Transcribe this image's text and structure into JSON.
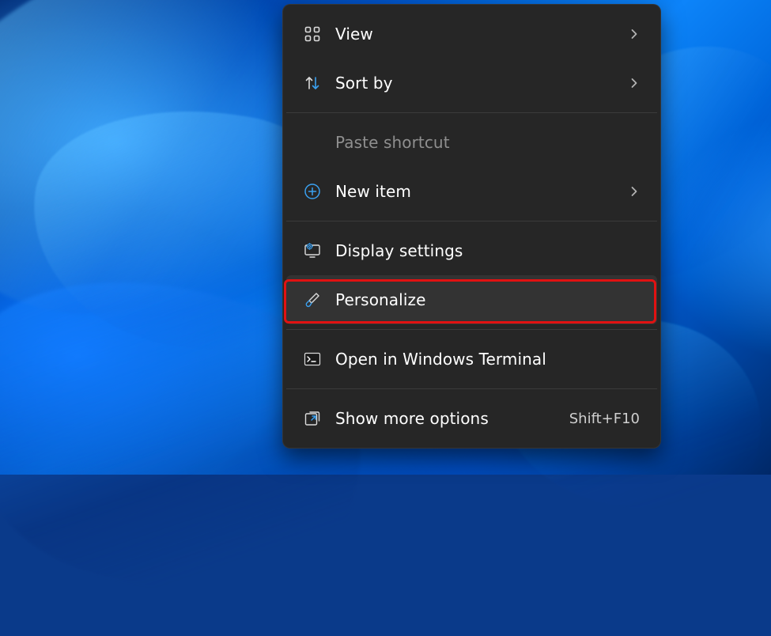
{
  "context_menu": {
    "items": [
      {
        "label": "View",
        "has_submenu": true
      },
      {
        "label": "Sort by",
        "has_submenu": true
      },
      {
        "label": "Paste shortcut",
        "disabled": true
      },
      {
        "label": "New item",
        "has_submenu": true
      },
      {
        "label": "Display settings"
      },
      {
        "label": "Personalize",
        "highlighted": true
      },
      {
        "label": "Open in Windows Terminal"
      },
      {
        "label": "Show more options",
        "shortcut": "Shift+F10"
      }
    ]
  }
}
